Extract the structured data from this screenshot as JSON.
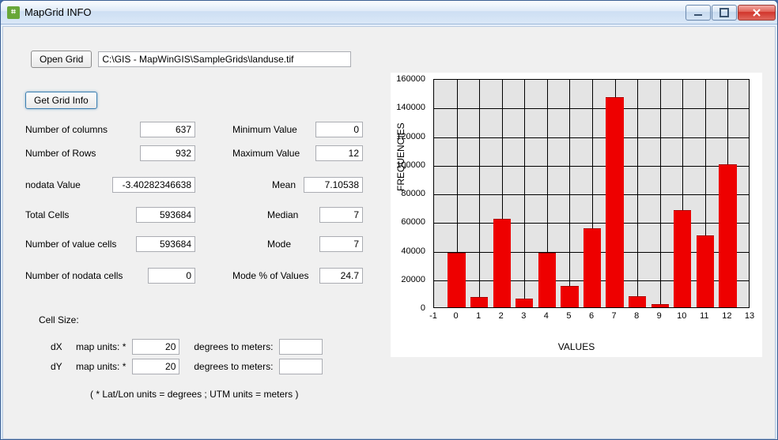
{
  "window": {
    "title": "MapGrid INFO"
  },
  "buttons": {
    "open_grid": "Open Grid",
    "get_info": "Get Grid Info"
  },
  "path": "C:\\GIS - MapWinGIS\\SampleGrids\\landuse.tif",
  "labels": {
    "num_cols": "Number of columns",
    "num_rows": "Number of  Rows",
    "nodata": "nodata Value",
    "total_cells": "Total Cells",
    "value_cells": "Number of  value cells",
    "nodata_cells": "Number of  nodata cells",
    "min": "Minimum Value",
    "max": "Maximum Value",
    "mean": "Mean",
    "median": "Median",
    "mode": "Mode",
    "mode_pct": "Mode % of Values",
    "cell_size": "Cell Size:",
    "dx": "dX",
    "dy": "dY",
    "map_units": "map units: *",
    "deg_to_m": "degrees to meters:",
    "footnote": "( * Lat/Lon units = degrees ;   UTM units = meters )"
  },
  "values": {
    "num_cols": "637",
    "num_rows": "932",
    "nodata": "-3.40282346638",
    "total_cells": "593684",
    "value_cells": "593684",
    "nodata_cells": "0",
    "min": "0",
    "max": "12",
    "mean": "7.10538",
    "median": "7",
    "mode": "7",
    "mode_pct": "24.7",
    "dx": "20",
    "dy": "20",
    "deg_to_m_x": "",
    "deg_to_m_y": ""
  },
  "chart_data": {
    "type": "bar",
    "title": "",
    "xlabel": "VALUES",
    "ylabel": "FREQUENCIES",
    "xlim": [
      -1,
      13
    ],
    "ylim": [
      0,
      160000
    ],
    "x_ticks": [
      -1,
      0,
      1,
      2,
      3,
      4,
      5,
      6,
      7,
      8,
      9,
      10,
      11,
      12,
      13
    ],
    "y_ticks": [
      0,
      20000,
      40000,
      60000,
      80000,
      100000,
      120000,
      140000,
      160000
    ],
    "categories": [
      0,
      1,
      2,
      3,
      4,
      5,
      6,
      7,
      8,
      9,
      10,
      11,
      12
    ],
    "values": [
      38000,
      7000,
      62000,
      6000,
      38000,
      15000,
      55000,
      147000,
      8000,
      2000,
      68000,
      50000,
      100000
    ]
  }
}
